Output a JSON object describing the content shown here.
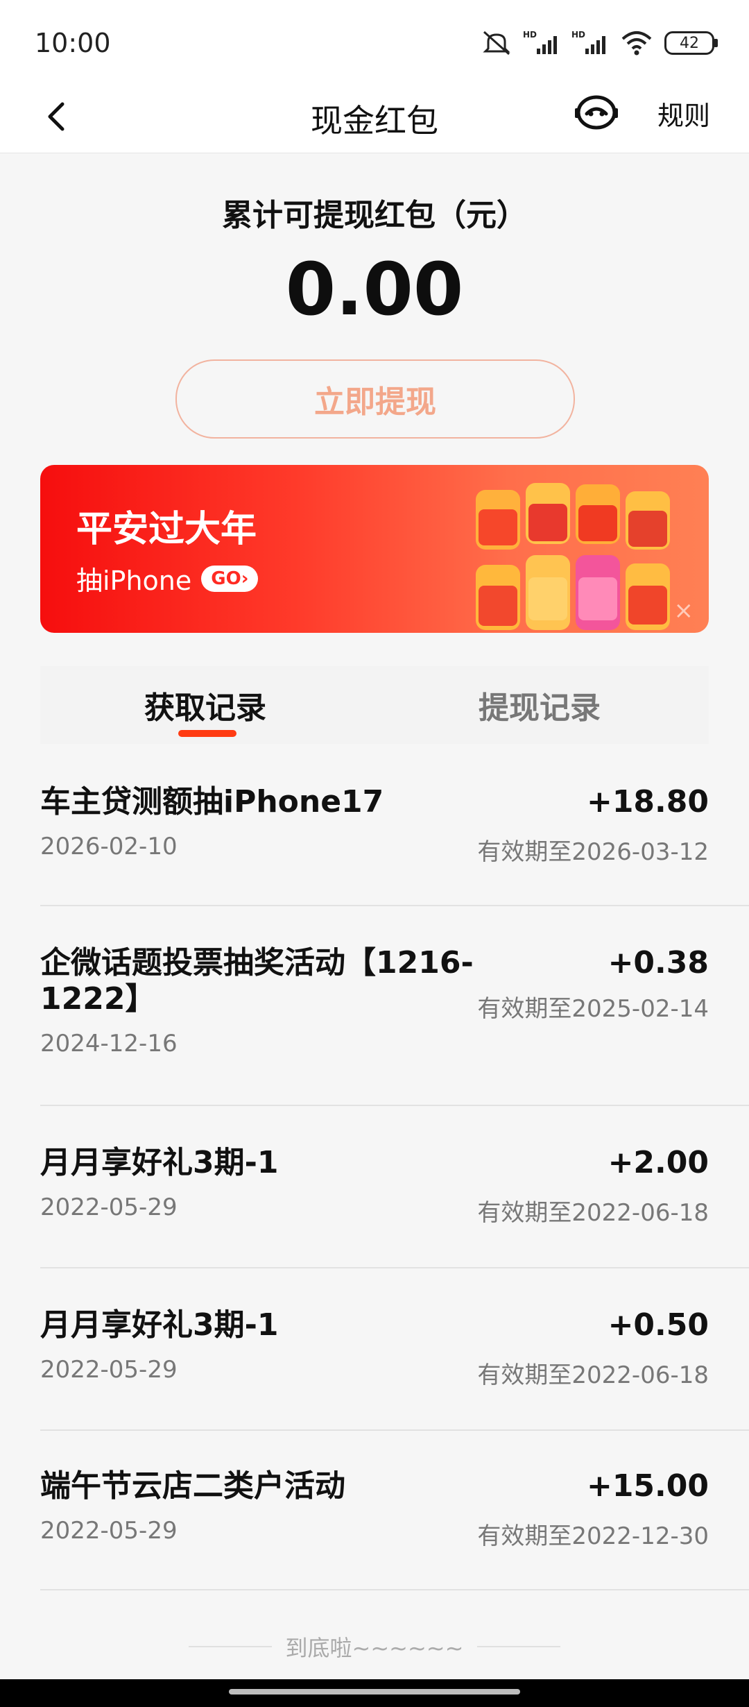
{
  "status_bar": {
    "time": "10:00",
    "battery": "42",
    "network_icons": [
      "mute-icon",
      "hd-signal-icon",
      "hd-signal-icon",
      "wifi-icon"
    ]
  },
  "header": {
    "title": "现金红包",
    "rules_label": "规则"
  },
  "balance": {
    "label": "累计可提现红包（元）",
    "amount": "0.00",
    "withdraw_label": "立即提现"
  },
  "banner": {
    "title": "平安过大年",
    "subtitle": "抽iPhone",
    "go_label": "GO",
    "close_label": "×"
  },
  "tabs": [
    {
      "label": "获取记录",
      "active": true
    },
    {
      "label": "提现记录",
      "active": false
    }
  ],
  "records": [
    {
      "title": "车主贷测额抽iPhone17",
      "date": "2026-02-10",
      "amount": "+18.80",
      "expire": "有效期至2026-03-12"
    },
    {
      "title": "企微话题投票抽奖活动【1216-1222】",
      "date": "2024-12-16",
      "amount": "+0.38",
      "expire": "有效期至2025-02-14"
    },
    {
      "title": "月月享好礼3期-1",
      "date": "2022-05-29",
      "amount": "+2.00",
      "expire": "有效期至2022-06-18"
    },
    {
      "title": "月月享好礼3期-1",
      "date": "2022-05-29",
      "amount": "+0.50",
      "expire": "有效期至2022-06-18"
    },
    {
      "title": "端午节云店二类户活动",
      "date": "2022-05-29",
      "amount": "+15.00",
      "expire": "有效期至2022-12-30"
    }
  ],
  "end_text": "到底啦~~~~~~",
  "colors": {
    "accent": "#ff3b12",
    "withdraw_text": "#f3a78a",
    "banner_start": "#f60e0e",
    "banner_end": "#ff8054"
  }
}
